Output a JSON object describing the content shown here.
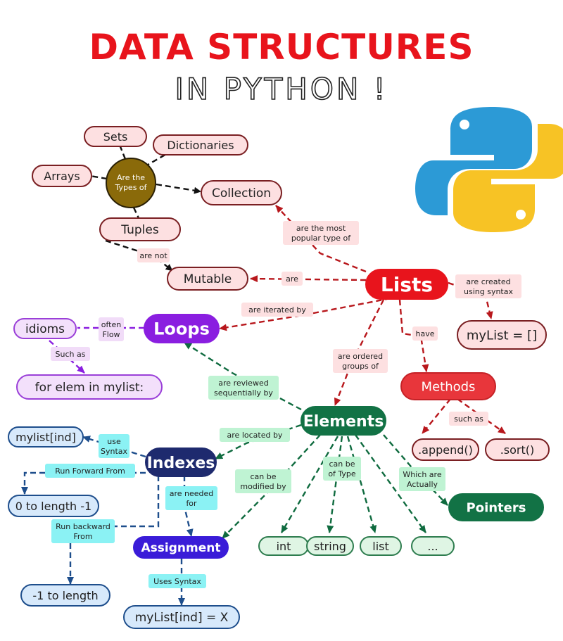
{
  "title": {
    "line1": "DATA STRUCTURES",
    "line2": "IN PYTHON !"
  },
  "nodes": {
    "sets": "Sets",
    "dictionaries": "Dictionaries",
    "arrays": "Arrays",
    "types_hub": [
      "Are the",
      "Types of"
    ],
    "collection": "Collection",
    "tuples": "Tuples",
    "mutable": "Mutable",
    "lists": "Lists",
    "mylist_empty": "myList = []",
    "loops": "Loops",
    "idioms": "idioms",
    "for_elem": "for elem in mylist:",
    "methods": "Methods",
    "append": ".append()",
    "sort": ".sort()",
    "elements": "Elements",
    "pointers": "Pointers",
    "indexes": "Indexes",
    "mylist_ind": "mylist[ind]",
    "zero_to_len": "0 to length -1",
    "neg_one_to_len": "-1 to length",
    "assignment": "Assignment",
    "mylist_assign": "myList[ind] = X",
    "int": "int",
    "string": "string",
    "list": "list",
    "ellipsis": "..."
  },
  "edge_labels": {
    "most_popular": [
      "are the most",
      "popular type of"
    ],
    "are_not": [
      "are not"
    ],
    "are": [
      "are"
    ],
    "created_syntax": [
      "are created",
      "using syntax"
    ],
    "iterated_by": [
      "are iterated by"
    ],
    "have": [
      "have"
    ],
    "ordered_groups": [
      "are ordered",
      "groups of"
    ],
    "often_flow": [
      "often",
      "Flow"
    ],
    "such_as_loops": [
      "Such as"
    ],
    "reviewed_seq": [
      "are reviewed",
      "sequentially by"
    ],
    "such_as_methods": [
      "such as"
    ],
    "located_by": [
      "are located by"
    ],
    "use_syntax": [
      "use",
      "Syntax"
    ],
    "run_forward": [
      "Run Forward From"
    ],
    "needed_for": [
      "are needed",
      "for"
    ],
    "modified_by": [
      "can be",
      "modified by"
    ],
    "can_be_type": [
      "can be",
      "of Type"
    ],
    "which_are": [
      "Which are",
      "Actually"
    ],
    "run_backward": [
      "Run backward",
      "From"
    ],
    "uses_syntax": [
      "Uses Syntax"
    ]
  },
  "colors": {
    "title_red": "#e8141c",
    "pink_fill": "#fde0e1",
    "pink_stroke": "#7a1f22",
    "lists_red": "#e8141c",
    "hub_brown": "#8a6a0a",
    "loops_purple": "#8a1ee0",
    "lavender_fill": "#f3e0fb",
    "elements_green": "#127245",
    "mint_fill": "#dff5e4",
    "indexes_navy": "#1e2a6e",
    "blue_fill": "#d7e9fb",
    "assignment_indigo": "#3a1cd8",
    "cyan_label": "#8bf2f4",
    "methods_red": "#e8363b",
    "python_blue": "#2c9ad6",
    "python_yellow": "#f7c325"
  },
  "icons": {
    "logo": "python-logo-icon"
  }
}
